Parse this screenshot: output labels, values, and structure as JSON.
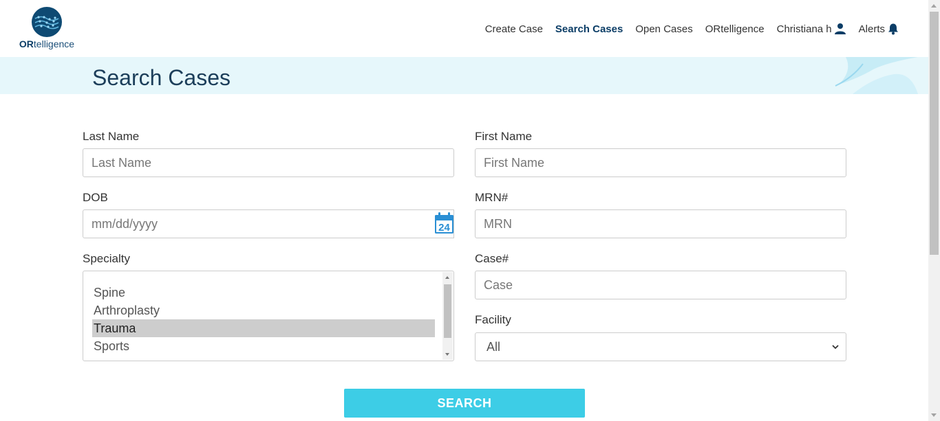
{
  "brand": {
    "logo_text_bold": "OR",
    "logo_text_rest": "telligence"
  },
  "nav": {
    "create_case": "Create Case",
    "search_cases": "Search Cases",
    "open_cases": "Open Cases",
    "ortelligence": "ORtelligence",
    "user": "Christiana h",
    "alerts": "Alerts"
  },
  "banner": {
    "title": "Search Cases"
  },
  "form": {
    "last_name": {
      "label": "Last Name",
      "placeholder": "Last Name",
      "value": ""
    },
    "first_name": {
      "label": "First Name",
      "placeholder": "First Name",
      "value": ""
    },
    "dob": {
      "label": "DOB",
      "placeholder": "mm/dd/yyyy",
      "value": "",
      "calendar_day": "24"
    },
    "mrn": {
      "label": "MRN#",
      "placeholder": "MRN",
      "value": ""
    },
    "specialty": {
      "label": "Specialty",
      "options": [
        "Spine",
        "Arthroplasty",
        "Trauma",
        "Sports"
      ],
      "selected": "Trauma"
    },
    "case": {
      "label": "Case#",
      "placeholder": "Case",
      "value": ""
    },
    "facility": {
      "label": "Facility",
      "selected": "All"
    }
  },
  "search_button": "SEARCH",
  "colors": {
    "accent": "#3dcde6",
    "brand": "#0b3d66",
    "banner_bg": "#e6f7fb",
    "calendar": "#2a8fd4"
  },
  "icons": {
    "user": "user-icon",
    "alerts": "bell-icon",
    "calendar": "calendar-icon",
    "facility_caret": "chevron-down-icon"
  }
}
